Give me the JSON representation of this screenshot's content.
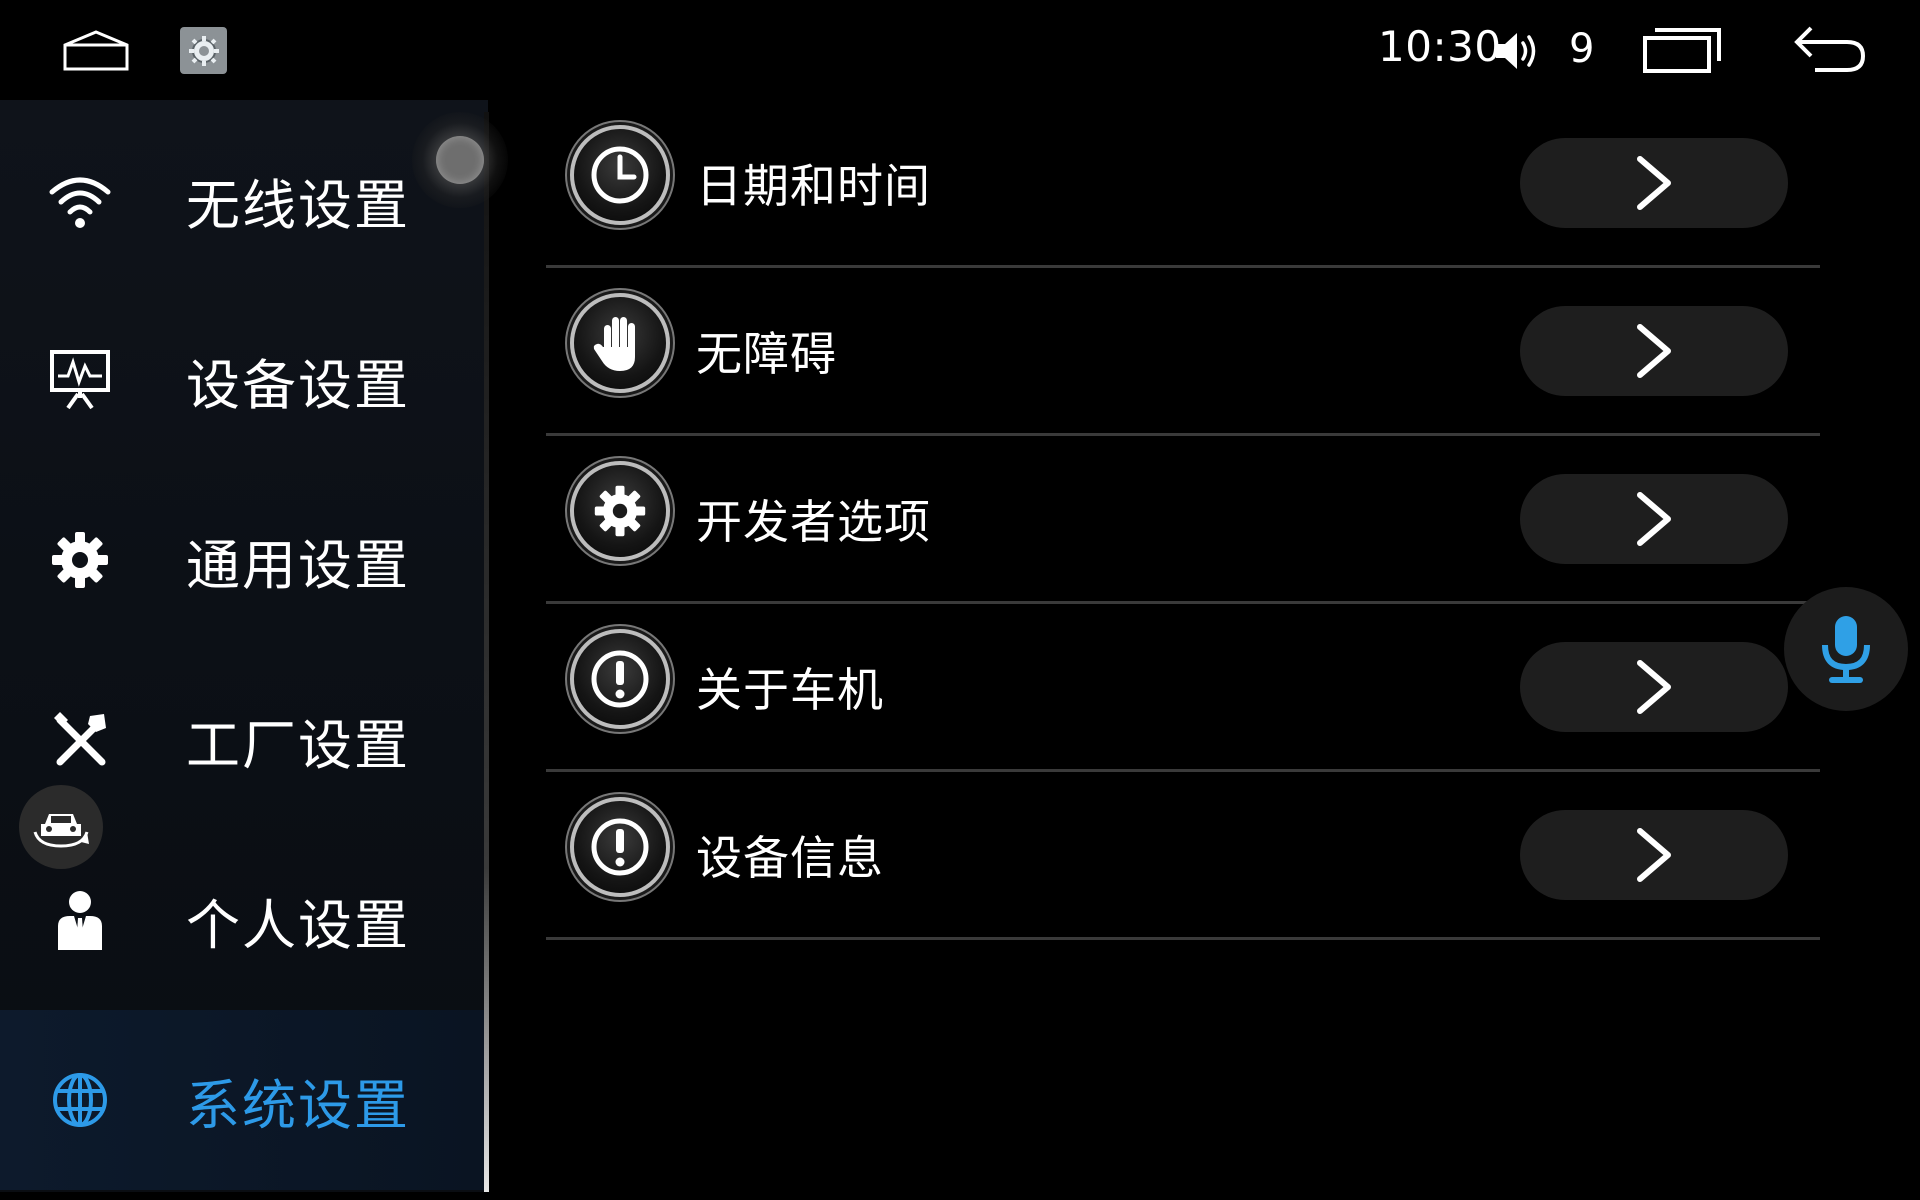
{
  "statusbar": {
    "time": "10:30",
    "volume_level": "9",
    "icons": [
      "home-icon",
      "settings-app-icon",
      "volume-icon",
      "recents-icon",
      "back-icon"
    ]
  },
  "sidebar": {
    "items": [
      {
        "label": "无线设置",
        "icon": "wifi-icon",
        "active": false
      },
      {
        "label": "设备设置",
        "icon": "monitor-chart-icon",
        "active": false
      },
      {
        "label": "通用设置",
        "icon": "gear-icon",
        "active": false
      },
      {
        "label": "工厂设置",
        "icon": "tools-icon",
        "active": false
      },
      {
        "label": "个人设置",
        "icon": "person-icon",
        "active": false
      },
      {
        "label": "系统设置",
        "icon": "globe-icon",
        "active": true
      }
    ],
    "active_color": "#2d9ae8"
  },
  "list": {
    "rows": [
      {
        "label": "日期和时间",
        "icon": "clock-icon"
      },
      {
        "label": "无障碍",
        "icon": "hand-icon"
      },
      {
        "label": "开发者选项",
        "icon": "gear-icon"
      },
      {
        "label": "关于车机",
        "icon": "info-icon"
      },
      {
        "label": "设备信息",
        "icon": "info-icon"
      }
    ]
  },
  "floating": {
    "mic_icon": "microphone-icon",
    "car_icon": "car-360-icon",
    "mic_color": "#2fa0e6"
  }
}
